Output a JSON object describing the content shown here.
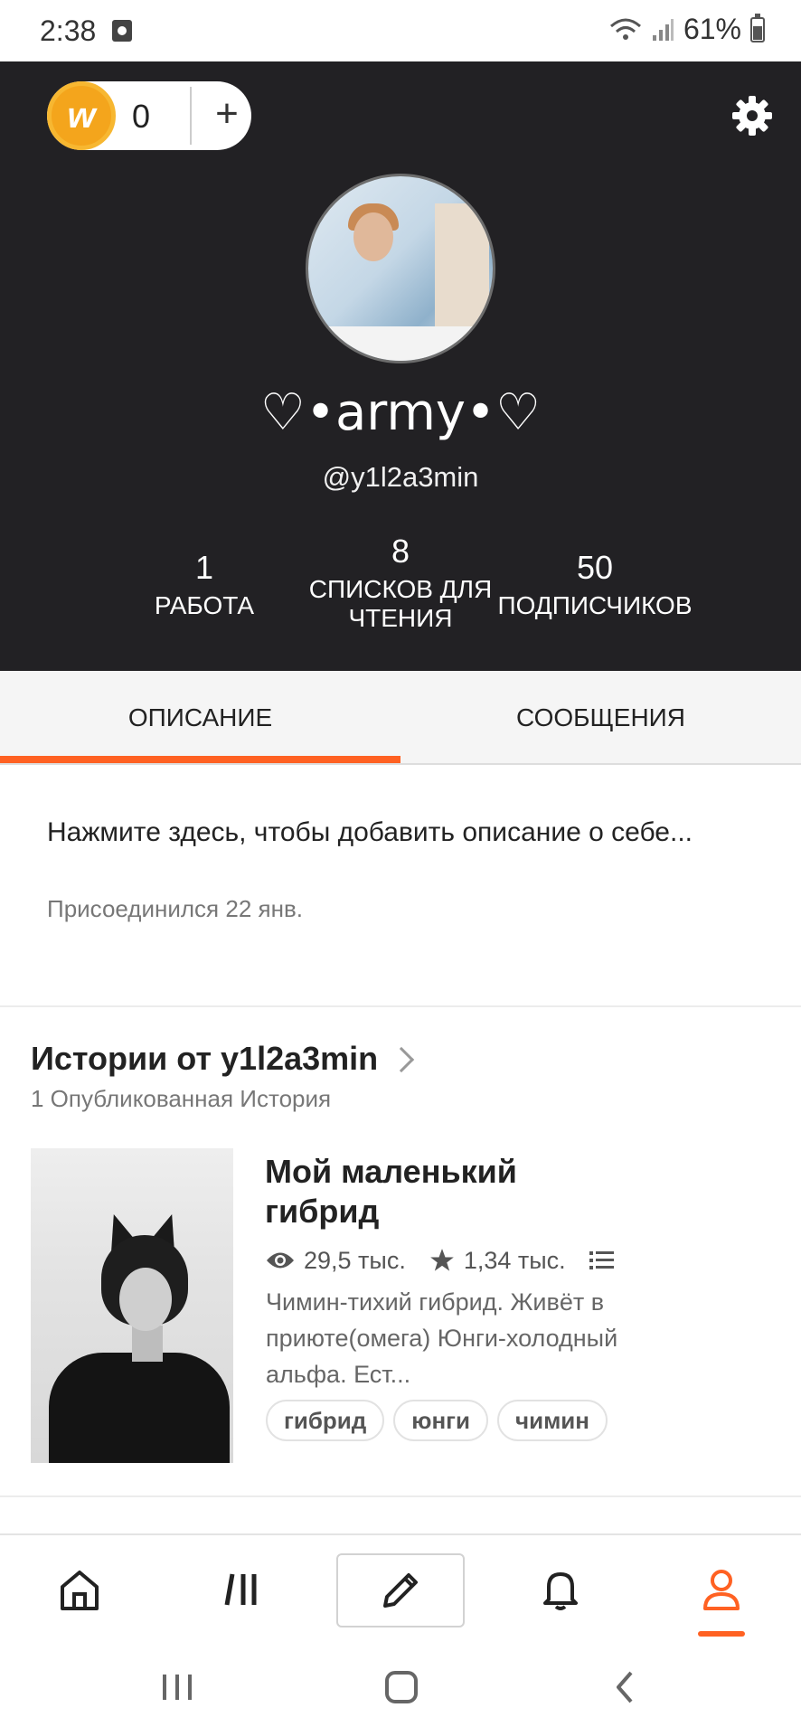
{
  "status_bar": {
    "time": "2:38",
    "battery": "61%"
  },
  "coins": {
    "count": "0",
    "plus": "+",
    "coin_letter": "w"
  },
  "profile": {
    "display_name": "♡•army•♡",
    "username": "@y1l2a3min",
    "stats": [
      {
        "number": "1",
        "label": "РАБОТА"
      },
      {
        "number": "8",
        "label": "СПИСКОВ ДЛЯ ЧТЕНИЯ"
      },
      {
        "number": "50",
        "label": "ПОДПИСЧИКОВ"
      }
    ]
  },
  "tabs": [
    {
      "label": "ОПИСАНИЕ",
      "active": true
    },
    {
      "label": "СООБЩЕНИЯ",
      "active": false
    }
  ],
  "about": {
    "placeholder": "Нажмите здесь, чтобы добавить описание о себе...",
    "joined": "Присоединился 22 янв."
  },
  "stories": {
    "title": "Истории от y1l2a3min",
    "subtitle": "1 Опубликованная История",
    "items": [
      {
        "title": "Мой маленький гибрид",
        "reads": "29,5 тыс.",
        "votes": "1,34 тыс.",
        "description": "Чимин-тихий гибрид. Живёт в приюте(омега) Юнги-холодный альфа. Ест...",
        "tags": [
          "гибрид",
          "юнги",
          "чимин"
        ]
      }
    ]
  },
  "nav": {
    "items": [
      "home",
      "library",
      "write",
      "notifications",
      "profile"
    ],
    "active": "profile",
    "accent": "#ff6122"
  },
  "colors": {
    "header_bg": "#222124",
    "accent": "#ff6122",
    "coin": "#f4a51c"
  }
}
